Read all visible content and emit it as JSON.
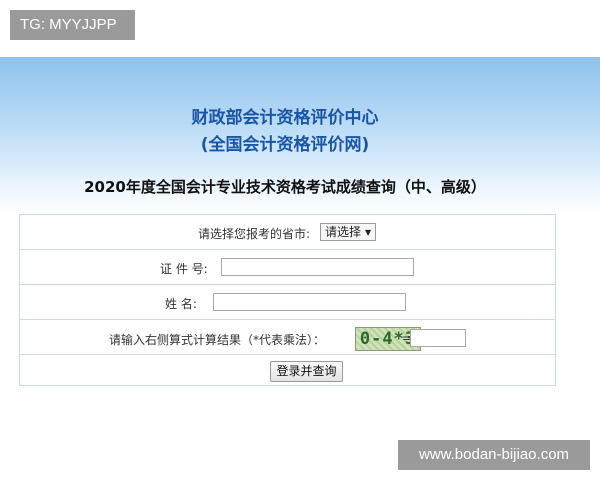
{
  "watermark_top": "TG: MYYJJPP",
  "watermark_bottom": "www.bodan-bijiao.com",
  "header": {
    "org_name": "财政部会计资格评价中心",
    "org_site": "(全国会计资格评价网)",
    "page_title": "2020年度全国会计专业技术资格考试成绩查询（中、高级）"
  },
  "form": {
    "province_label": "请选择您报考的省市:",
    "province_select_value": "请选择",
    "id_label": "证 件 号:",
    "id_value": "",
    "name_label": "姓  名:",
    "name_value": "",
    "captcha_label": "请输入右侧算式计算结果（*代表乘法）：",
    "captcha_text": "0-4*3",
    "equals": "=",
    "captcha_value": "",
    "submit_label": "登录并查询"
  },
  "colors": {
    "header_blue": "#1a56a8",
    "border": "#c9dcea",
    "badge_bg": "#9a9a9a"
  }
}
